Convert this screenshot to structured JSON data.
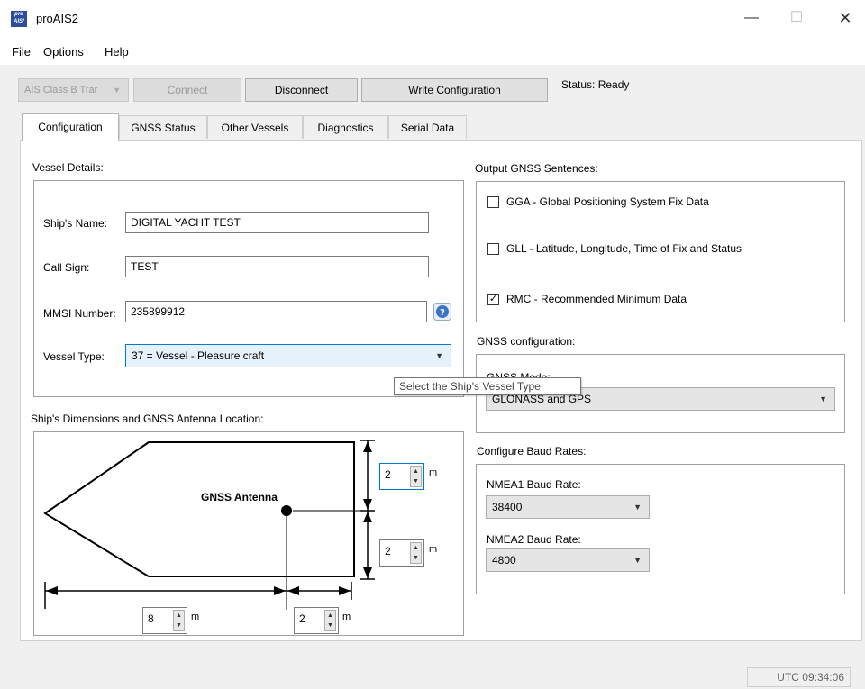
{
  "window": {
    "title": "proAIS2",
    "icon_top": "pro",
    "icon_bottom": "AIS²"
  },
  "menu": [
    "File",
    "Options",
    "Help"
  ],
  "toolbar": {
    "device_select": "AIS Class B Trar",
    "connect_label": "Connect",
    "disconnect_label": "Disconnect",
    "write_config_label": "Write Configuration",
    "status": "Status: Ready"
  },
  "tabs": [
    "Configuration",
    "GNSS Status",
    "Other Vessels",
    "Diagnostics",
    "Serial Data"
  ],
  "vessel": {
    "heading": "Vessel Details:",
    "ship_name_label": "Ship's Name:",
    "ship_name": "DIGITAL YACHT TEST",
    "call_sign_label": "Call Sign:",
    "call_sign": "TEST",
    "mmsi_label": "MMSI Number:",
    "mmsi": "235899912",
    "vessel_type_label": "Vessel Type:",
    "vessel_type": "37 = Vessel - Pleasure craft",
    "tooltip": "Select the Ship's Vessel Type"
  },
  "dimensions": {
    "heading": "Ship's Dimensions and GNSS Antenna Location:",
    "antenna_label": "GNSS Antenna",
    "bow_to_antenna": "8",
    "antenna_to_stern": "2",
    "port_to_antenna": "2",
    "antenna_to_starboard": "2",
    "unit": "m"
  },
  "output": {
    "heading": "Output GNSS Sentences:",
    "gga": {
      "label": "GGA - Global Positioning System Fix Data",
      "checked": false
    },
    "gll": {
      "label": "GLL - Latitude, Longitude, Time of Fix and Status",
      "checked": false
    },
    "rmc": {
      "label": "RMC - Recommended Minimum Data",
      "checked": true
    }
  },
  "gnss": {
    "heading": "GNSS configuration:",
    "mode_label": "GNSS Mode:",
    "mode": "GLONASS and GPS"
  },
  "baud": {
    "heading": "Configure Baud Rates:",
    "nmea1_label": "NMEA1 Baud Rate:",
    "nmea1": "38400",
    "nmea2_label": "NMEA2 Baud Rate:",
    "nmea2": "4800"
  },
  "statusbar": {
    "utc": "UTC 09:34:06"
  }
}
